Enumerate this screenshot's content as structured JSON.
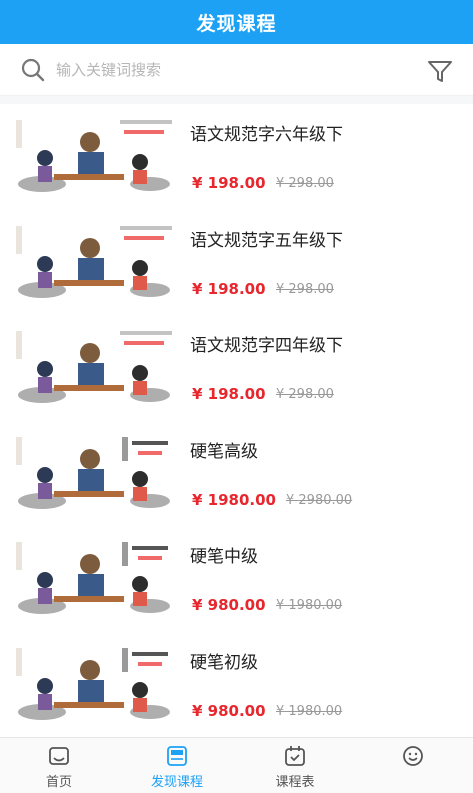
{
  "header": {
    "title": "发现课程"
  },
  "search": {
    "placeholder": "输入关键词搜索"
  },
  "courses": [
    {
      "title": "语文规范字六年级下",
      "price": "¥ 198.00",
      "old_price": "¥ 298.00"
    },
    {
      "title": "语文规范字五年级下",
      "price": "¥ 198.00",
      "old_price": "¥ 298.00"
    },
    {
      "title": "语文规范字四年级下",
      "price": "¥ 198.00",
      "old_price": "¥ 298.00"
    },
    {
      "title": "硬笔高级",
      "price": "¥ 1980.00",
      "old_price": "¥ 2980.00"
    },
    {
      "title": "硬笔中级",
      "price": "¥ 980.00",
      "old_price": "¥ 1980.00"
    },
    {
      "title": "硬笔初级",
      "price": "¥ 980.00",
      "old_price": "¥ 1980.00"
    }
  ],
  "tabs": [
    {
      "label": "首页",
      "icon": "home-icon"
    },
    {
      "label": "发现课程",
      "icon": "discover-icon",
      "active": true
    },
    {
      "label": "课程表",
      "icon": "calendar-icon"
    },
    {
      "label": "",
      "icon": "smile-icon"
    }
  ],
  "colors": {
    "brand": "#1da1f5",
    "price": "#e8262d",
    "muted": "#999999"
  }
}
